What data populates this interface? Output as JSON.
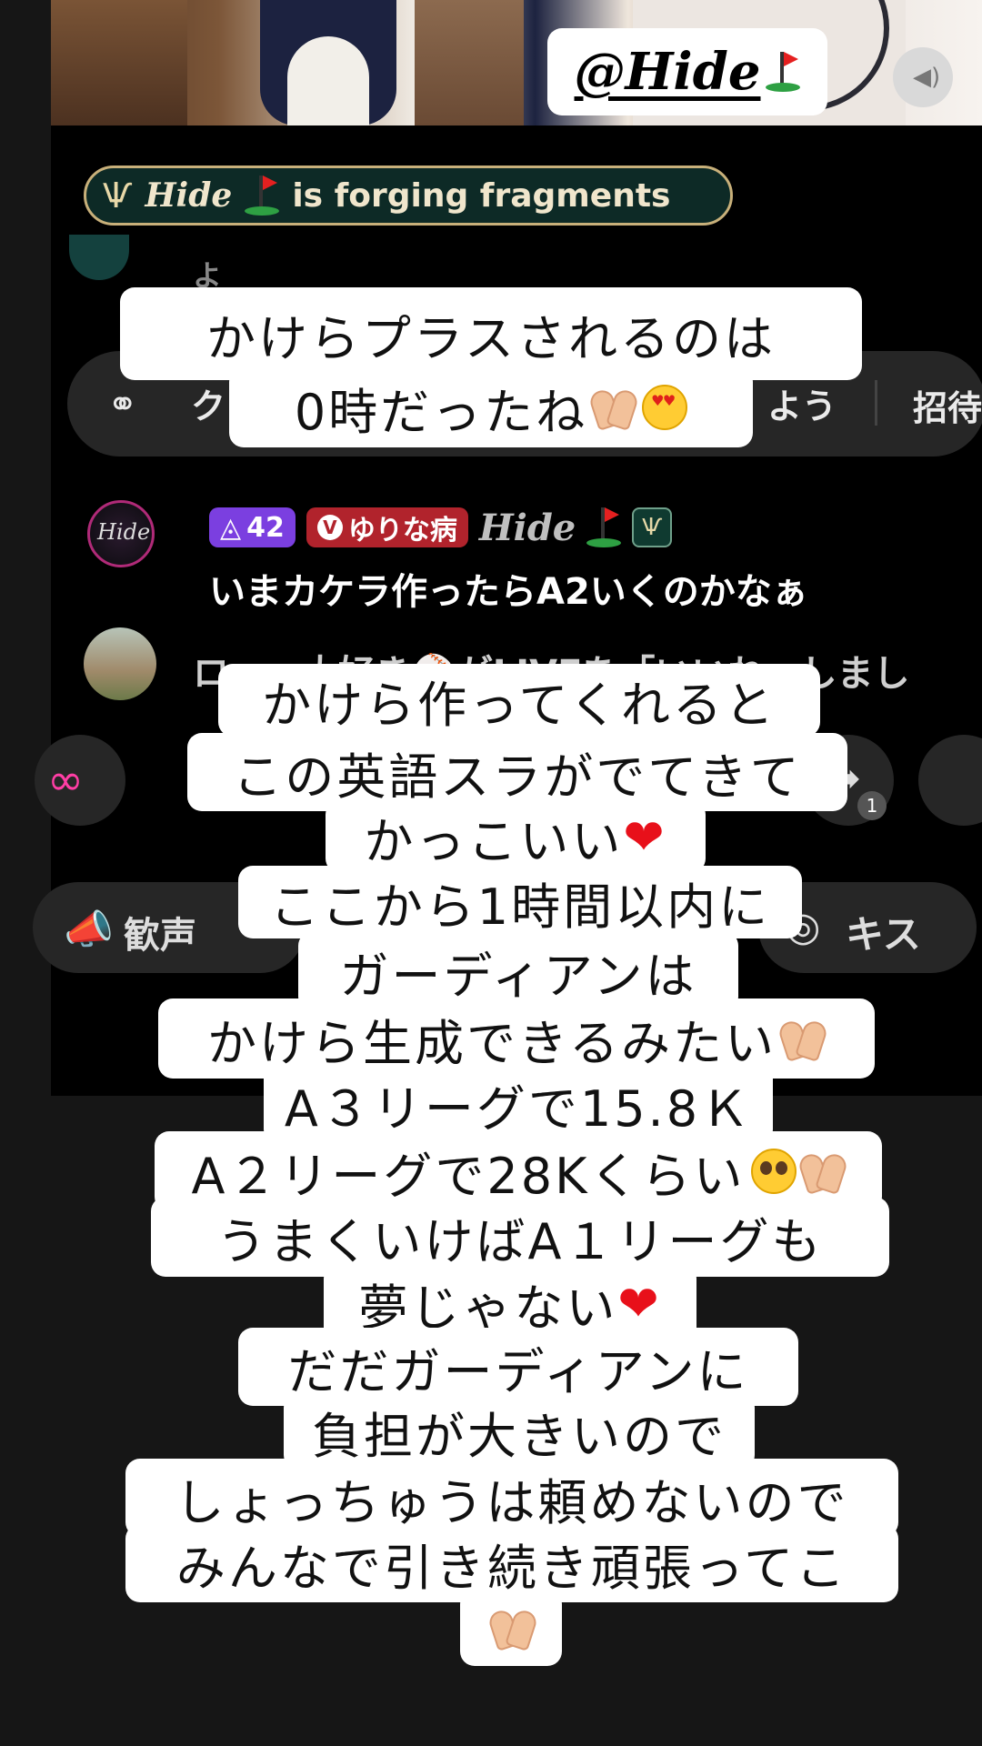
{
  "live": {
    "mention_tag": "@Hide",
    "banner": {
      "name": "Hide",
      "message": "is forging fragments"
    },
    "faded_chat_text": "よう",
    "action_bar": {
      "left_text": "クリ",
      "right_text": "よう",
      "invite": "招待"
    },
    "chat_message": {
      "avatar_text": "Hide",
      "level": "42",
      "fan_badge": "ゆりな病",
      "fan_badge_v": "V",
      "username": "Hide",
      "text": "いまカケラ作ったらA2いくのかなぁ"
    },
    "like_line": "ロ・・大好き⚾がLIVEを「いいね」しまし",
    "share_count": "1",
    "cheer_label": "歓声",
    "kiss_label": "キス"
  },
  "captions": {
    "c1_line1": "かけらプラスされるのは",
    "c1_line2": "0時だったね",
    "c2": [
      "かけら作ってくれると",
      "この英語スラがでてきて",
      "かっこいい",
      "ここから1時間以内に",
      "ガーディアンは",
      "かけら生成できるみたい",
      "A３リーグで15.8Ｋ",
      "A２リーグで28Kくらい",
      "うまくいけばA１リーグも",
      "夢じゃない",
      "だだガーディアンに",
      "負担が大きいので",
      "しょっちゅうは頼めないので",
      "みんなで引き続き頑張ってこ"
    ]
  },
  "colors": {
    "banner_bg": "#0d2a26",
    "banner_border": "#c8b07a",
    "level_badge": "#7b3fe0",
    "fan_badge": "#b1232c",
    "heart": "#e8101a"
  },
  "icons": [
    "golf-flag-icon",
    "speaker-icon",
    "antler-icon",
    "handshake-icon",
    "loop-icon",
    "share-icon",
    "megaphone-icon",
    "lips-icon",
    "heart-emoji",
    "heart-hands-emoji",
    "heart-eyes-emoji",
    "pleading-face-emoji"
  ]
}
